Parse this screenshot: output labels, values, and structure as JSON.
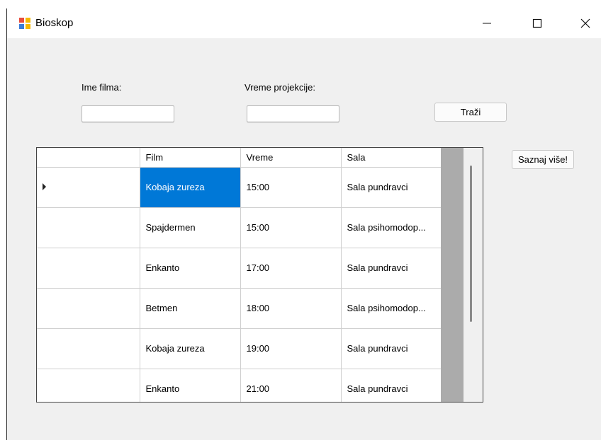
{
  "window": {
    "title": "Bioskop",
    "icon": "windows-form-icon"
  },
  "controls": {
    "movie_label": "Ime filma:",
    "movie_value": "",
    "time_label": "Vreme projekcije:",
    "time_value": "",
    "search_button": "Traži",
    "more_button": "Saznaj više!"
  },
  "grid": {
    "columns": [
      "Film",
      "Vreme",
      "Sala"
    ],
    "rows": [
      {
        "film": "Kobaja zureza",
        "time": "15:00",
        "hall": "Sala pundravci",
        "current": true
      },
      {
        "film": "Spajdermen",
        "time": "15:00",
        "hall": "Sala psihomodop..."
      },
      {
        "film": "Enkanto",
        "time": "17:00",
        "hall": "Sala pundravci"
      },
      {
        "film": "Betmen",
        "time": "18:00",
        "hall": "Sala psihomodop..."
      },
      {
        "film": "Kobaja zureza",
        "time": "19:00",
        "hall": "Sala pundravci"
      },
      {
        "film": "Enkanto",
        "time": "21:00",
        "hall": "Sala pundravci"
      }
    ]
  },
  "colors": {
    "selection": "#0078d7",
    "scrollbar_track": "#ababab",
    "window_bg": "#f0f0f0"
  }
}
